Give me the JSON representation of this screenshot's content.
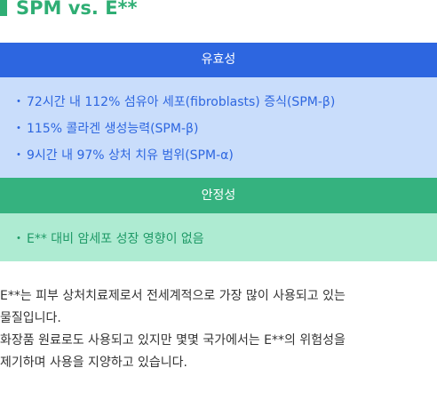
{
  "title": "SPM vs.  E**",
  "efficacy": {
    "header": "유효성",
    "bullet": "・",
    "items": [
      "72시간 내 112% 섬유아 세포(fibroblasts) 증식(SPM-β)",
      "115% 콜라겐 생성능력(SPM-β)",
      "9시간 내 97% 상처 치유 범위(SPM-α)"
    ]
  },
  "safety": {
    "header": "안정성",
    "bullet": "・",
    "items": [
      "E** 대비 암세포 성장 영향이 없음"
    ]
  },
  "description": {
    "lines": [
      "E**는 피부 상처치료제로서 전세계적으로 가장 많이 사용되고 있는",
      "물질입니다.",
      "화장품 원료로도 사용되고 있지만 몇몇 국가에서는 E**의 위험성을",
      "제기하며 사용을 지양하고 있습니다."
    ]
  },
  "colors": {
    "title": "#2fae74",
    "efficacy_header": "#2d66e0",
    "efficacy_body": "#c9ddfb",
    "safety_header": "#35b27f",
    "safety_body": "#aeebd2"
  }
}
